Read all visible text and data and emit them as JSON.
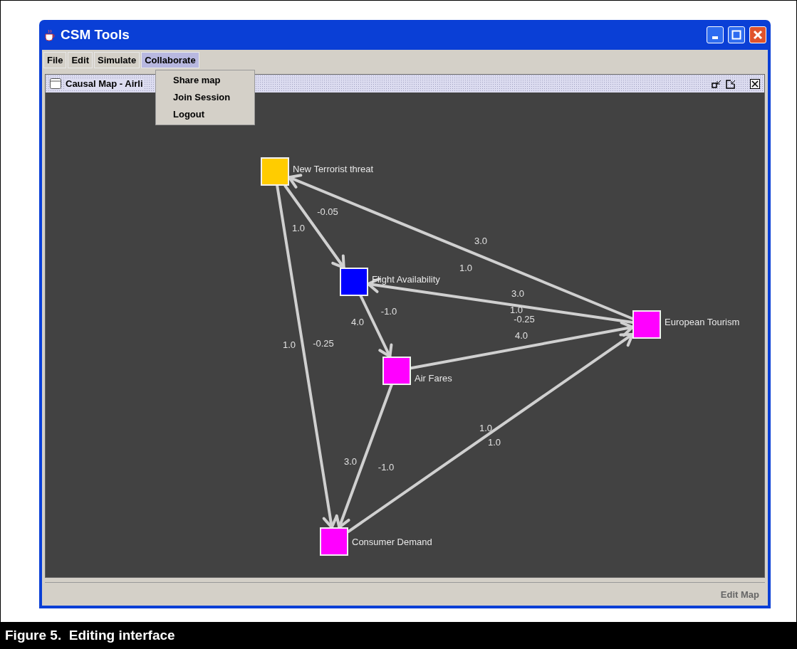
{
  "window": {
    "title": "CSM Tools"
  },
  "menu": [
    {
      "label": "File",
      "selected": false
    },
    {
      "label": "Edit",
      "selected": false
    },
    {
      "label": "Simulate",
      "selected": false
    },
    {
      "label": "Collaborate",
      "selected": true
    }
  ],
  "dropdown": [
    "Share map",
    "Join Session",
    "Logout"
  ],
  "internal_frame": {
    "title": "Causal Map - Airli"
  },
  "nodes": [
    {
      "label": "New Terrorist threat",
      "color": "#ffcc00"
    },
    {
      "label": "Flight Availability",
      "color": "#0000ff"
    },
    {
      "label": "Air Fares",
      "color": "#ff00ff"
    },
    {
      "label": "European Tourism",
      "color": "#ff00ff"
    },
    {
      "label": "Consumer Demand",
      "color": "#ff00ff"
    }
  ],
  "edges": [
    {
      "labels": [
        "3.0",
        "1.0"
      ]
    },
    {
      "labels": [
        "3.0",
        "1.0"
      ]
    },
    {
      "labels": [
        "-0.25",
        "4.0"
      ]
    },
    {
      "labels": [
        "1.0",
        "1.0"
      ]
    },
    {
      "labels": [
        "1.0",
        "-0.05"
      ]
    },
    {
      "labels": [
        "4.0",
        "-1.0"
      ]
    },
    {
      "labels": [
        "1.0",
        "-0.25"
      ]
    },
    {
      "labels": [
        "3.0",
        "-1.0"
      ]
    }
  ],
  "status_bar": "Edit Map",
  "caption": "Figure 5.  Editing interface"
}
